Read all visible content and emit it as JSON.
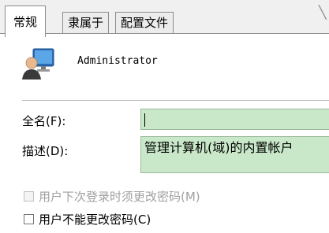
{
  "tabs": [
    {
      "label": "常规",
      "active": true
    },
    {
      "label": "隶属于",
      "active": false
    },
    {
      "label": "配置文件",
      "active": false
    }
  ],
  "user": {
    "name": "Administrator",
    "avatar_icon": "user-monitor-icon"
  },
  "fields": {
    "fullname": {
      "label": "全名(F):",
      "value": ""
    },
    "description": {
      "label": "描述(D):",
      "value": "管理计算机(域)的内置帐户"
    }
  },
  "options": {
    "must_change": {
      "label": "用户下次登录时须更改密码(M)",
      "checked": false,
      "enabled": false
    },
    "cannot_change": {
      "label": "用户不能更改密码(C)",
      "checked": false,
      "enabled": true
    }
  },
  "colors": {
    "field_highlight": "#c9e8c9",
    "disabled_text": "#a0a0a0"
  }
}
